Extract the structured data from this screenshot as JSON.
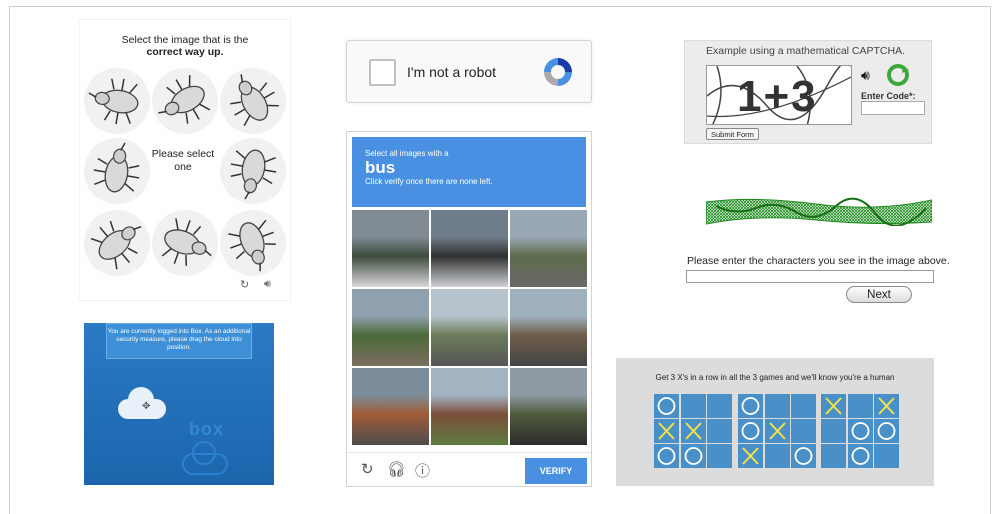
{
  "orientation_captcha": {
    "title_line1": "Select the image that is the",
    "title_line2": "correct way up.",
    "center_text": "Please select one",
    "refresh_icon": "refresh-icon",
    "audio_icon": "audio-icon"
  },
  "box_captcha": {
    "message": "You are currently logged into Box. As an additional security measure, please drag the cloud into position.",
    "logo": "box"
  },
  "recaptcha_checkbox": {
    "label": "I'm not a robot"
  },
  "recaptcha_images": {
    "instruction_line1": "Select all images with a",
    "target": "bus",
    "instruction_line3": "Click verify once there are none left.",
    "verify_label": "VERIFY",
    "footer_icons": [
      "reload-icon",
      "headphones-icon",
      "info-icon"
    ]
  },
  "math_captcha": {
    "title": "Example using a mathematical CAPTCHA.",
    "image_text": "1+3",
    "enter_code_label": "Enter Code*:",
    "code_value": "",
    "submit_label": "Submit Form"
  },
  "text_captcha": {
    "prompt": "Please enter the characters you see in the image above.",
    "input_value": "",
    "next_label": "Next"
  },
  "tictactoe_captcha": {
    "title": "Get 3 X's in a row in all the 3 games and we'll know you're a human",
    "boards": [
      [
        "O",
        "",
        "",
        "X",
        "X",
        "",
        "O",
        "O",
        ""
      ],
      [
        "O",
        "",
        "",
        "O",
        "X",
        "",
        "X",
        "",
        "O"
      ],
      [
        "X",
        "",
        "X",
        "",
        "O",
        "O",
        "",
        "O",
        ""
      ]
    ],
    "colors": {
      "cell": "#4a90c8",
      "x": "#f2e24a",
      "o": "#ffffff"
    }
  }
}
